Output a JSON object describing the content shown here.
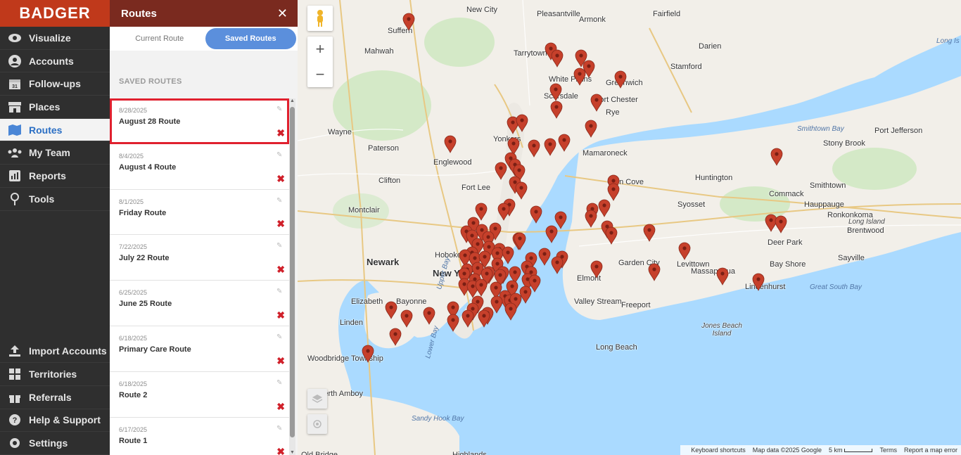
{
  "app": {
    "logo": "BADGER"
  },
  "nav": {
    "top": [
      {
        "label": "Visualize",
        "icon": "eye-icon"
      },
      {
        "label": "Accounts",
        "icon": "person-icon"
      },
      {
        "label": "Follow-ups",
        "icon": "calendar-icon"
      },
      {
        "label": "Places",
        "icon": "store-icon"
      },
      {
        "label": "Routes",
        "icon": "map-icon"
      },
      {
        "label": "My Team",
        "icon": "team-icon"
      },
      {
        "label": "Reports",
        "icon": "report-icon"
      },
      {
        "label": "Tools",
        "icon": "tools-icon"
      }
    ],
    "bottom": [
      {
        "label": "Import Accounts",
        "icon": "upload-icon"
      },
      {
        "label": "Territories",
        "icon": "grid-icon"
      },
      {
        "label": "Referrals",
        "icon": "gift-icon"
      },
      {
        "label": "Help & Support",
        "icon": "help-icon"
      },
      {
        "label": "Settings",
        "icon": "gear-icon"
      }
    ],
    "active": "Routes"
  },
  "panel": {
    "title": "Routes",
    "close": "✕",
    "tabs": [
      "Current Route",
      "Saved Routes"
    ],
    "active_tab": "Saved Routes",
    "section": "SAVED ROUTES",
    "routes": [
      {
        "date": "8/28/2025",
        "name": "August 28 Route",
        "selected": true
      },
      {
        "date": "8/4/2025",
        "name": "August 4 Route"
      },
      {
        "date": "8/1/2025",
        "name": "Friday Route"
      },
      {
        "date": "7/22/2025",
        "name": "July 22 Route"
      },
      {
        "date": "6/25/2025",
        "name": "June 25 Route"
      },
      {
        "date": "6/18/2025",
        "name": "Primary Care Route"
      },
      {
        "date": "6/18/2025",
        "name": "Route 2"
      },
      {
        "date": "6/17/2025",
        "name": "Route 1"
      }
    ]
  },
  "map": {
    "controls": {
      "zoom_in": "+",
      "zoom_out": "−"
    },
    "places": [
      "Suffern",
      "New City",
      "Pleasantville",
      "Armonk",
      "Fairfield",
      "Tarrytown",
      "Darien",
      "Stamford",
      "White Plains",
      "Greenwich",
      "Mahwah",
      "Scarsdale",
      "Port Chester",
      "Rye",
      "Yonkers",
      "Paterson",
      "Wayne",
      "Englewood",
      "Mamaroneck",
      "Clifton",
      "Fort Lee",
      "Glen Cove",
      "Huntington",
      "Commack",
      "Smithtown",
      "Hauppauge",
      "Stony Brook",
      "Port Jefferson",
      "Montclair",
      "Ronkonkoma",
      "Brentwood",
      "Newark",
      "New York",
      "Hoboken",
      "Syosset",
      "Deer Park",
      "Sayville",
      "Garden City",
      "Levittown",
      "Massapequa",
      "Lindenhurst",
      "Bay Shore",
      "Elizabeth",
      "Bayonne",
      "Elmont",
      "Valley Stream",
      "Freeport",
      "Linden",
      "Long Beach",
      "Woodbridge Township",
      "Perth Amboy",
      "Old Bridge",
      "Highlands"
    ],
    "waters": [
      "Long Is",
      "Smithtown Bay",
      "Great South Bay",
      "Lower Bay",
      "Sandy Hook Bay",
      "Upper Bay"
    ],
    "islands": [
      "Jones Beach Island",
      "Long Island"
    ],
    "attribution": [
      "Keyboard shortcuts",
      "Map data ©2025 Google",
      "5 km",
      "Terms",
      "Report a map error"
    ],
    "marker_color": "#c6402b"
  }
}
